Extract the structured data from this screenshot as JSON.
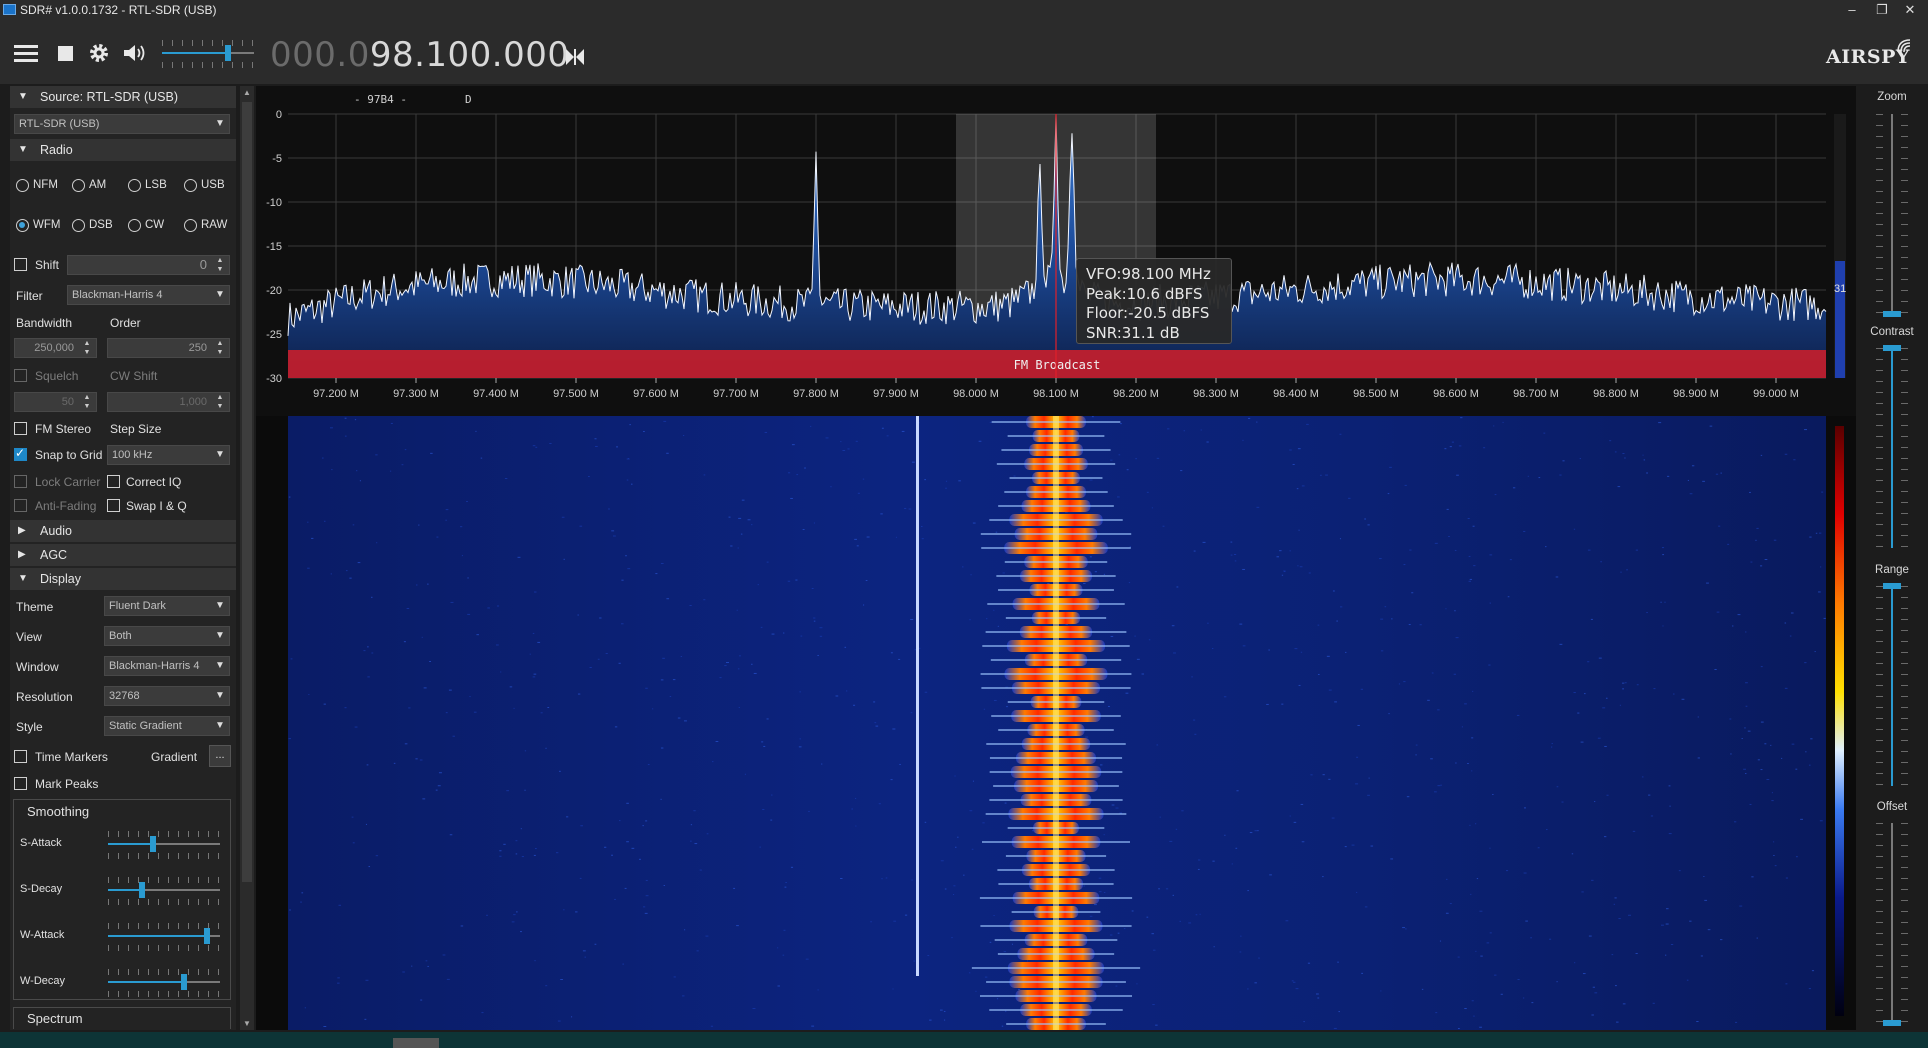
{
  "window": {
    "title": "SDR# v1.0.0.1732 - RTL-SDR (USB)",
    "controls": [
      "–",
      "❐",
      "✕"
    ]
  },
  "toolbar": {
    "freq_dim": "000.0",
    "freq_bright": "98.100.000",
    "logo": "AIRSPY",
    "icons": [
      "menu-icon",
      "stop-icon",
      "gear-icon",
      "speaker-icon",
      "skip-icon"
    ],
    "volume_level": 0.72
  },
  "source": {
    "header": "Source: RTL-SDR (USB)",
    "device": "RTL-SDR (USB)"
  },
  "radio": {
    "header": "Radio",
    "modes": [
      {
        "label": "NFM",
        "selected": false
      },
      {
        "label": "AM",
        "selected": false
      },
      {
        "label": "LSB",
        "selected": false
      },
      {
        "label": "USB",
        "selected": false
      },
      {
        "label": "WFM",
        "selected": true
      },
      {
        "label": "DSB",
        "selected": false
      },
      {
        "label": "CW",
        "selected": false
      },
      {
        "label": "RAW",
        "selected": false
      }
    ],
    "shift_label": "Shift",
    "shift_value": "0",
    "filter_label": "Filter",
    "filter_value": "Blackman-Harris 4",
    "bandwidth_label": "Bandwidth",
    "order_label": "Order",
    "bandwidth_value": "250,000",
    "order_value": "250",
    "squelch_label": "Squelch",
    "cw_shift_label": "CW Shift",
    "squelch_value": "50",
    "cw_shift_value": "1,000",
    "fm_stereo_label": "FM Stereo",
    "step_size_label": "Step Size",
    "snap_label": "Snap to Grid",
    "step_value": "100 kHz",
    "lock_carrier_label": "Lock Carrier",
    "correct_iq_label": "Correct IQ",
    "anti_fading_label": "Anti-Fading",
    "swap_iq_label": "Swap I & Q"
  },
  "sections": {
    "audio": "Audio",
    "agc": "AGC",
    "display": "Display"
  },
  "display": {
    "theme_label": "Theme",
    "theme_value": "Fluent Dark",
    "view_label": "View",
    "view_value": "Both",
    "window_label": "Window",
    "window_value": "Blackman-Harris 4",
    "resolution_label": "Resolution",
    "resolution_value": "32768",
    "style_label": "Style",
    "style_value": "Static Gradient",
    "time_markers_label": "Time Markers",
    "gradient_label": "Gradient",
    "gradient_button": "...",
    "mark_peaks_label": "Mark Peaks"
  },
  "smoothing": {
    "header": "Smoothing",
    "sliders": [
      {
        "label": "S-Attack",
        "level": 0.4
      },
      {
        "label": "S-Decay",
        "level": 0.3
      },
      {
        "label": "W-Attack",
        "level": 0.88
      },
      {
        "label": "W-Decay",
        "level": 0.68
      }
    ]
  },
  "spectrum_section": "Spectrum",
  "spectrum": {
    "rds_text": "- 97B4 -",
    "rds_flag": "D",
    "band_label": "FM Broadcast",
    "snr_side": "31",
    "y_ticks": [
      "0",
      "-5",
      "-10",
      "-15",
      "-20",
      "-25",
      "-30"
    ],
    "x_ticks": [
      "97.200 M",
      "97.300 M",
      "97.400 M",
      "97.500 M",
      "97.600 M",
      "97.700 M",
      "97.800 M",
      "97.900 M",
      "98.000 M",
      "98.100 M",
      "98.200 M",
      "98.300 M",
      "98.400 M",
      "98.500 M",
      "98.600 M",
      "98.700 M",
      "98.800 M",
      "98.900 M",
      "99.000 M"
    ],
    "tooltip": [
      "VFO:98.100 MHz",
      "Peak:10.6 dBFS",
      "Floor:-20.5 dBFS",
      "SNR:31.1 dB"
    ],
    "colors": {
      "spectrum_fill": "#1e4f9e",
      "band": "#c41e2d",
      "vfo": "#e0202a",
      "waterfall_bg": "#0a1e6e"
    }
  },
  "right_panel": {
    "zoom_label": "Zoom",
    "contrast_label": "Contrast",
    "range_label": "Range",
    "offset_label": "Offset"
  }
}
